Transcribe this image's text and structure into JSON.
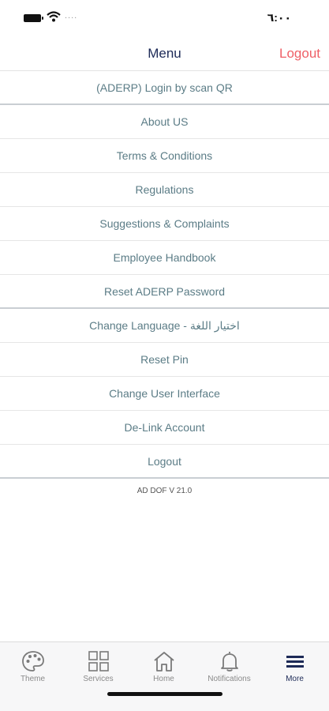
{
  "status": {
    "time": "٦:٠٠",
    "signal_dots": "...."
  },
  "header": {
    "title": "Menu",
    "logout_label": "Logout"
  },
  "menu": {
    "items": [
      "(ADERP) Login by scan QR",
      "About US",
      "Terms & Conditions",
      "Regulations",
      "Suggestions & Complaints",
      "Employee Handbook",
      "Reset ADERP Password",
      "Change Language - اختيار اللغة",
      "Reset Pin",
      "Change User Interface",
      "De-Link Account",
      "Logout"
    ]
  },
  "version": "AD DOF V 21.0",
  "tabbar": {
    "tabs": [
      {
        "label": "Theme",
        "icon": "palette-icon"
      },
      {
        "label": "Services",
        "icon": "grid-icon"
      },
      {
        "label": "Home",
        "icon": "home-icon"
      },
      {
        "label": "Notifications",
        "icon": "bell-icon"
      },
      {
        "label": "More",
        "icon": "menu-icon",
        "active": true
      }
    ]
  },
  "colors": {
    "title": "#1d2a57",
    "logout": "#ef5f66",
    "menu_text": "#5b7c86",
    "tab_inactive": "#8a8a8a",
    "tab_active": "#1d2a57"
  }
}
